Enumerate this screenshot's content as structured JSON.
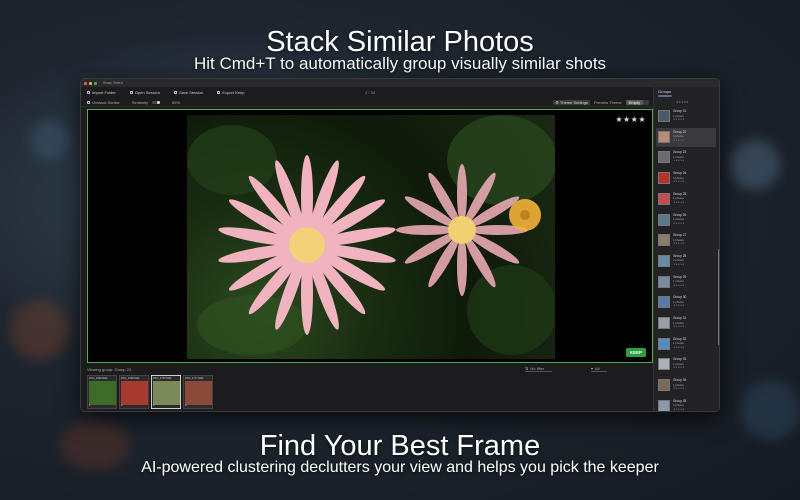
{
  "headline": {
    "title": "Stack Similar Photos",
    "subtitle": "Hit Cmd+T to automatically group visually similar shots"
  },
  "footer": {
    "title": "Find Your Best Frame",
    "subtitle": "AI-powered clustering declutters your view and helps you pick the keeper"
  },
  "window": {
    "app_name": "Sharp Select",
    "toolbar": [
      {
        "label": "Import Folder",
        "icon": "folder-icon"
      },
      {
        "label": "Open Session",
        "icon": "open-icon"
      },
      {
        "label": "Save Session",
        "icon": "save-icon"
      },
      {
        "label": "Export Keep",
        "icon": "export-icon"
      }
    ],
    "counter": "3 / 34",
    "subbar": {
      "unstack_label": "Unstack Similar",
      "similarity_label": "Similarity",
      "similarity_value": "85%",
      "theme_label": "Theme Settings",
      "preview_label": "Preview Theme",
      "segments": [
        "Empty",
        ""
      ]
    },
    "viewer": {
      "stars": "★★★★",
      "keep_label": "KEEP"
    },
    "bottombar": {
      "viewing": "Viewing group: Group 22",
      "sort": "No filter",
      "filter": "All"
    },
    "filmstrip": [
      {
        "name": "DSC_4599.NEF",
        "num": "1",
        "stars": "★★",
        "color": "#3e6a2a",
        "active": false
      },
      {
        "name": "DSC_4568.NEF",
        "num": "2",
        "stars": "",
        "color": "#a63a2e",
        "active": false
      },
      {
        "name": "DSC_4735.NEF",
        "num": "3",
        "stars": "★★★★",
        "color": "#7a8a5a",
        "active": true
      },
      {
        "name": "DSC_4777.NEF",
        "num": "4",
        "stars": "",
        "color": "#8a4a3a",
        "active": false
      }
    ],
    "groups_panel": {
      "title": "Groups",
      "top_stars": "★★★★★",
      "groups": [
        {
          "name": "Group 21",
          "count": "1 photos",
          "stars": "★★★★★",
          "color": "#4a5a6a",
          "selected": false
        },
        {
          "name": "Group 22",
          "count": "4 photos",
          "stars": "★★★★★",
          "color": "#b88a7a",
          "selected": true
        },
        {
          "name": "Group 23",
          "count": "1 photos",
          "stars": "★★★★★",
          "color": "#6a6a6e",
          "selected": false
        },
        {
          "name": "Group 24",
          "count": "3 photos",
          "stars": "★★★★★",
          "color": "#b8322a",
          "selected": false
        },
        {
          "name": "Group 25",
          "count": "1 photos",
          "stars": "★★★★★",
          "color": "#c84a52",
          "selected": false
        },
        {
          "name": "Group 26",
          "count": "1 photos",
          "stars": "★★★★★",
          "color": "#5a7a8a",
          "selected": false
        },
        {
          "name": "Group 27",
          "count": "1 photos",
          "stars": "★★★★★",
          "color": "#8a7a6a",
          "selected": false
        },
        {
          "name": "Group 28",
          "count": "2 photos",
          "stars": "★★★★★",
          "color": "#6a8aaa",
          "selected": false
        },
        {
          "name": "Group 29",
          "count": "1 photos",
          "stars": "★★★★★",
          "color": "#7a8a9a",
          "selected": false
        },
        {
          "name": "Group 30",
          "count": "1 photos",
          "stars": "★★★★★",
          "color": "#5a7aaa",
          "selected": false
        },
        {
          "name": "Group 31",
          "count": "1 photos",
          "stars": "★★★★★",
          "color": "#9aa0aa",
          "selected": false
        },
        {
          "name": "Group 32",
          "count": "1 photos",
          "stars": "★★★★★",
          "color": "#5a8aba",
          "selected": false
        },
        {
          "name": "Group 33",
          "count": "1 photos",
          "stars": "★★★★★",
          "color": "#aab0ba",
          "selected": false
        },
        {
          "name": "Group 34",
          "count": "1 photos",
          "stars": "★★★★★",
          "color": "#7a6a5a",
          "selected": false
        },
        {
          "name": "Group 35",
          "count": "3 photos",
          "stars": "★★★★★",
          "color": "#8a9aaa",
          "selected": false
        }
      ]
    }
  }
}
